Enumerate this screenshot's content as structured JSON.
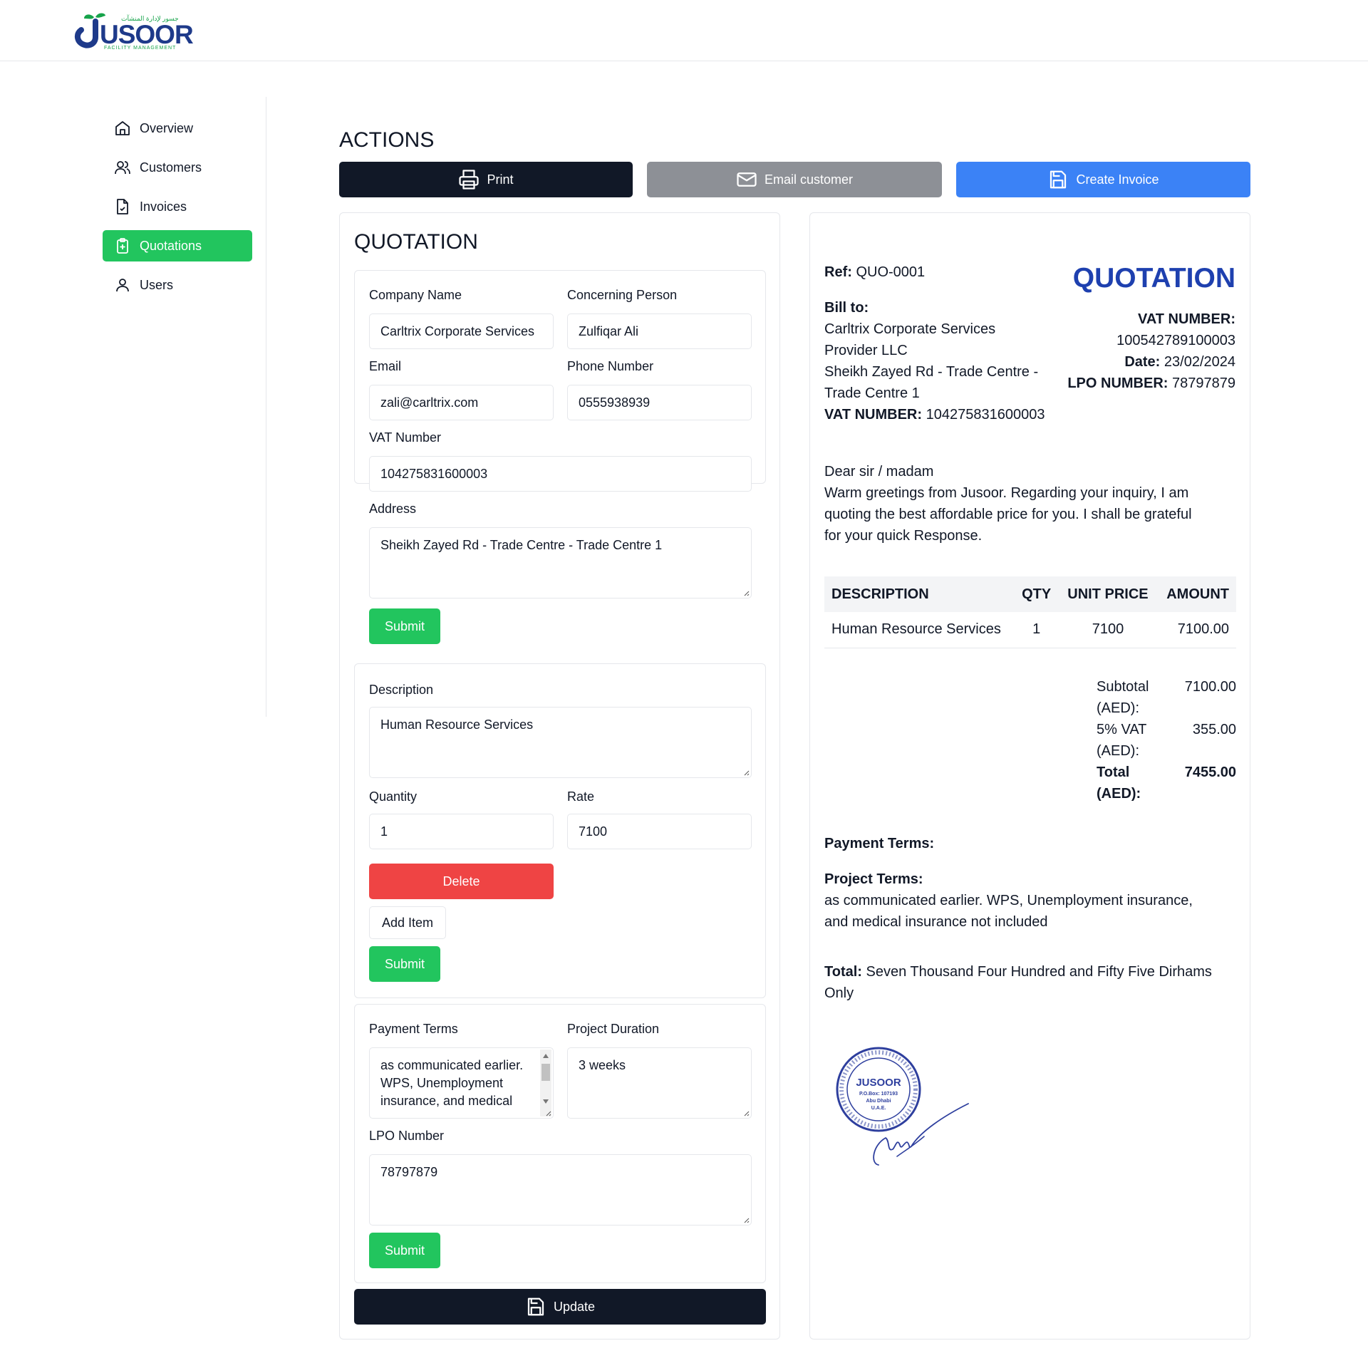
{
  "brand": {
    "name": "USOOR",
    "subtitle": "FACILITY MANAGEMENT",
    "arabic": "جسور لإدارة المنشآت"
  },
  "sidebar": {
    "items": [
      {
        "label": "Overview",
        "icon": "home-icon",
        "active": false
      },
      {
        "label": "Customers",
        "icon": "users-icon",
        "active": false
      },
      {
        "label": "Invoices",
        "icon": "file-check-icon",
        "active": false
      },
      {
        "label": "Quotations",
        "icon": "clipboard-plus-icon",
        "active": true
      },
      {
        "label": "Users",
        "icon": "user-icon",
        "active": false
      }
    ]
  },
  "actions": {
    "title": "ACTIONS",
    "print": "Print",
    "email": "Email customer",
    "create_invoice": "Create Invoice"
  },
  "form": {
    "title": "QUOTATION",
    "company": {
      "label": "Company Name",
      "value": "Carltrix Corporate Services"
    },
    "person": {
      "label": "Concerning Person",
      "value": "Zulfiqar Ali"
    },
    "email": {
      "label": "Email",
      "value": "zali@carltrix.com"
    },
    "phone": {
      "label": "Phone Number",
      "value": "0555938939"
    },
    "vat": {
      "label": "VAT Number",
      "value": "104275831600003"
    },
    "address": {
      "label": "Address",
      "value": "Sheikh Zayed Rd - Trade Centre - Trade Centre 1"
    },
    "submit": "Submit",
    "item": {
      "desc_label": "Description",
      "desc_value": "Human Resource Services",
      "qty_label": "Quantity",
      "qty_value": "1",
      "rate_label": "Rate",
      "rate_value": "7100",
      "delete": "Delete",
      "add_item": "Add Item"
    },
    "terms": {
      "payment_label": "Payment Terms",
      "payment_value": "as communicated earlier. WPS, Unemployment insurance, and medical",
      "duration_label": "Project Duration",
      "duration_value": "3 weeks",
      "lpo_label": "LPO Number",
      "lpo_value": "78797879"
    },
    "update": "Update"
  },
  "preview": {
    "ref_label": "Ref:",
    "ref_value": "QUO-0001",
    "title": "QUOTATION",
    "bill_to_label": "Bill to:",
    "bill_company_1": "Carltrix Corporate Services",
    "bill_company_2": "Provider LLC",
    "bill_address_1": "Sheikh Zayed Rd - Trade Centre -",
    "bill_address_2": "Trade Centre 1",
    "bill_vat_label": "VAT NUMBER:",
    "bill_vat_value": "104275831600003",
    "vat_label": "VAT NUMBER:",
    "vat_value": "100542789100003",
    "date_label": "Date:",
    "date_value": "23/02/2024",
    "lpo_label": "LPO NUMBER:",
    "lpo_value": "78797879",
    "greeting": "Dear sir / madam",
    "body_1": "Warm greetings from Jusoor. Regarding your inquiry, I am",
    "body_2": "quoting the best affordable price for you. I shall be grateful",
    "body_3": "for your quick Response.",
    "table": {
      "headers": [
        "DESCRIPTION",
        "QTY",
        "UNIT PRICE",
        "AMOUNT"
      ],
      "rows": [
        {
          "description": "Human Resource Services",
          "qty": "1",
          "unit_price": "7100",
          "amount": "7100.00"
        }
      ]
    },
    "subtotal_label_1": "Subtotal",
    "subtotal_label_2": "(AED):",
    "subtotal_value": "7100.00",
    "vat5_label_1": "5% VAT",
    "vat5_label_2": "(AED):",
    "vat5_value": "355.00",
    "total_label_1": "Total",
    "total_label_2": "(AED):",
    "total_value": "7455.00",
    "payment_terms_label": "Payment Terms:",
    "project_terms_label": "Project Terms:",
    "project_terms_1": "as communicated earlier. WPS, Unemployment insurance,",
    "project_terms_2": "and medical insurance not included",
    "total_words_label": "Total:",
    "total_words_1": "Seven Thousand Four Hundred and Fifty Five Dirhams",
    "total_words_2": "Only",
    "stamp_text": {
      "name": "JUSOOR",
      "po": "P.O.Box: 107193",
      "city": "Abu Dhabi",
      "country": "U.A.E."
    }
  },
  "colors": {
    "green": "#22c55e",
    "blue": "#3b82f6",
    "navy": "#111827",
    "red": "#ef4444",
    "title_blue": "#1e40af"
  }
}
